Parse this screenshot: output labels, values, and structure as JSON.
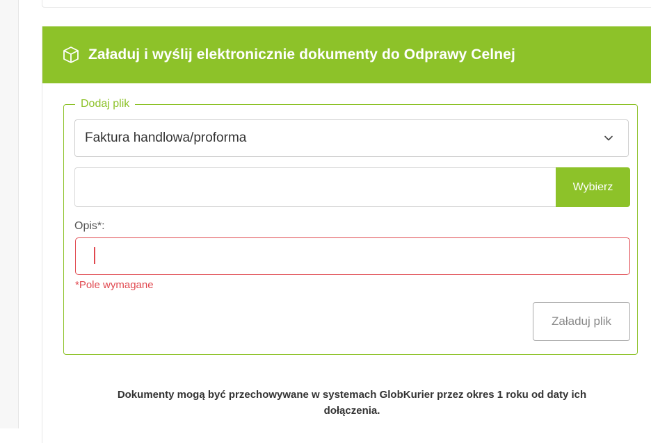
{
  "header": {
    "title": "Załaduj i wyślij elektronicznie dokumenty do Odprawy Celnej",
    "icon": "box-icon"
  },
  "upload_form": {
    "legend": "Dodaj plik",
    "document_type": {
      "selected": "Faktura handlowa/proforma"
    },
    "file": {
      "value": "",
      "choose_label": "Wybierz"
    },
    "description": {
      "label": "Opis*:",
      "value": "",
      "error": "*Pole wymagane"
    },
    "submit_label": "Załaduj plik"
  },
  "footer_note": {
    "line1": "Dokumenty mogą być przechowywane w systemach GlobKurier przez okres 1 roku od daty ich",
    "line2": "dołączenia."
  },
  "colors": {
    "accent": "#8dc229",
    "error": "#e0484f"
  }
}
